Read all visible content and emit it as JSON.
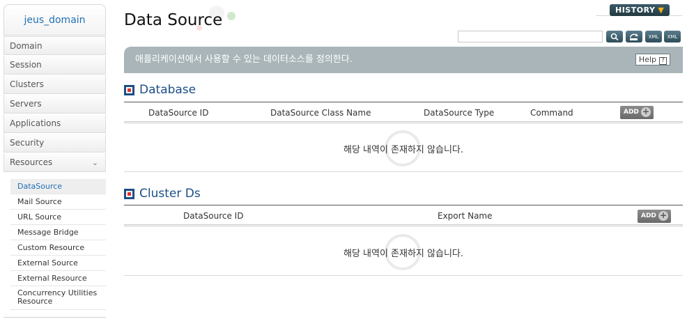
{
  "sidebar": {
    "domain": "jeus_domain",
    "menu": [
      {
        "label": "Domain"
      },
      {
        "label": "Session"
      },
      {
        "label": "Clusters"
      },
      {
        "label": "Servers"
      },
      {
        "label": "Applications"
      },
      {
        "label": "Security"
      },
      {
        "label": "Resources"
      }
    ],
    "submenu": [
      {
        "label": "DataSource"
      },
      {
        "label": "Mail Source"
      },
      {
        "label": "URL Source"
      },
      {
        "label": "Message Bridge"
      },
      {
        "label": "Custom Resource"
      },
      {
        "label": "External Source"
      },
      {
        "label": "External Resource"
      },
      {
        "label": "Concurrency Utilities",
        "label2": "Resource"
      }
    ]
  },
  "header": {
    "title": "Data Source",
    "history_label": "HISTORY",
    "search_value": ""
  },
  "toolbar": {
    "search_icon": "magnifier-icon",
    "refresh_icon": "refresh-icon",
    "xml_label_1": "XML",
    "xml_label_2": "XML"
  },
  "banner": {
    "text": "애플리케이션에서 사용할 수 있는 데이터소스를 정의한다.",
    "help_label": "Help",
    "help_mark": "?"
  },
  "database": {
    "title": "Database",
    "columns": [
      "DataSource ID",
      "DataSource Class Name",
      "DataSource Type",
      "Command"
    ],
    "add_label": "ADD",
    "empty_text": "해당 내역이 존재하지 않습니다."
  },
  "cluster": {
    "title": "Cluster Ds",
    "columns": [
      "DataSource ID",
      "Export Name"
    ],
    "add_label": "ADD",
    "empty_text": "해당 내역이 존재하지 않습니다."
  },
  "colors": {
    "accent": "#1b4f86",
    "banner": "#a9b5b9",
    "history": "#2e4a52"
  }
}
